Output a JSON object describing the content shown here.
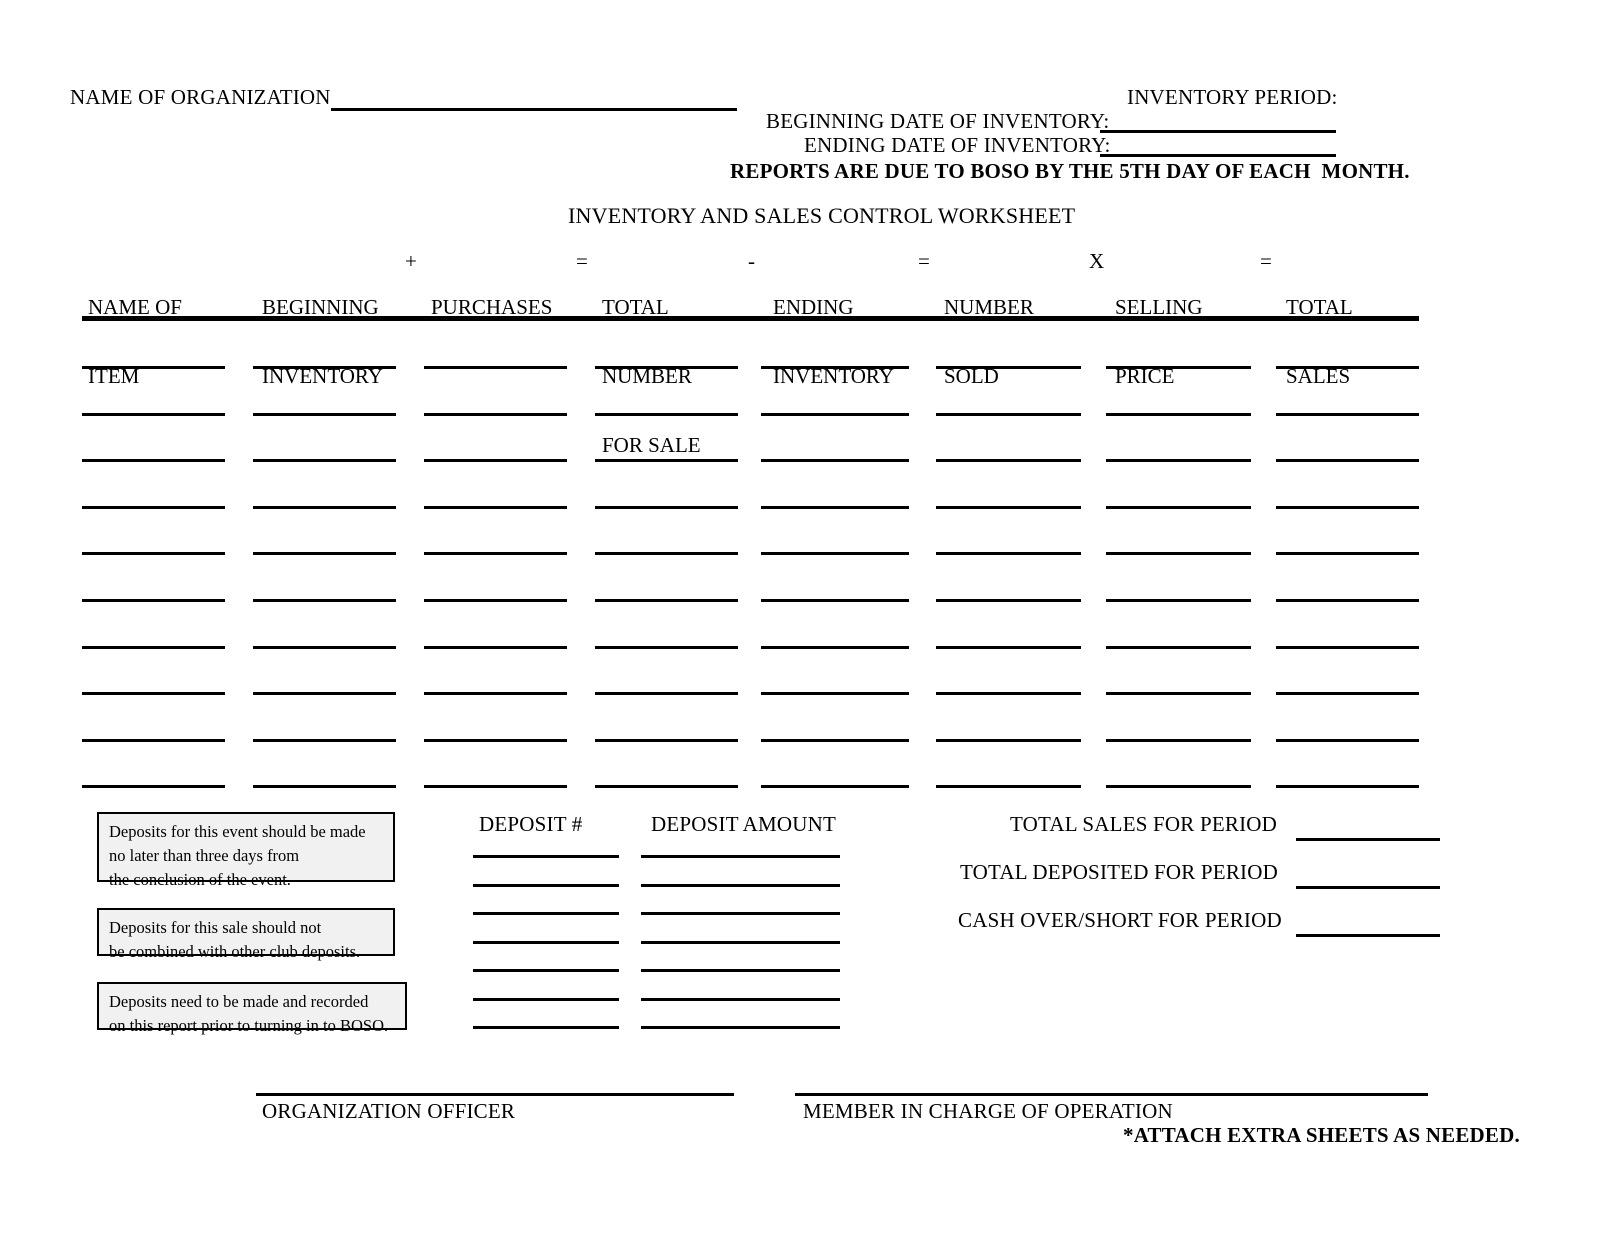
{
  "header": {
    "org_label": "NAME OF ORGANIZATION",
    "inventory_period_label": "INVENTORY PERIOD:",
    "beginning_date_label": "BEGINNING DATE OF INVENTORY:",
    "ending_date_label": "ENDING DATE OF INVENTORY:",
    "due_notice": "REPORTS ARE DUE TO BOSO BY THE 5TH DAY OF EACH  MONTH.",
    "org_value": "",
    "beginning_date_value": "",
    "ending_date_value": ""
  },
  "title": "INVENTORY AND SALES CONTROL WORKSHEET",
  "table": {
    "columns": [
      {
        "line1": "NAME OF",
        "line2": "ITEM",
        "line3": "",
        "operator": ""
      },
      {
        "line1": "BEGINNING",
        "line2": "INVENTORY",
        "line3": "",
        "operator": ""
      },
      {
        "line1": "PURCHASES",
        "line2": "",
        "line3": "",
        "operator": "+"
      },
      {
        "line1": "TOTAL",
        "line2": "NUMBER",
        "line3": "FOR SALE",
        "operator": "="
      },
      {
        "line1": "ENDING",
        "line2": "INVENTORY",
        "line3": "",
        "operator": "-"
      },
      {
        "line1": "NUMBER",
        "line2": "SOLD",
        "line3": "",
        "operator": "="
      },
      {
        "line1": "SELLING",
        "line2": "PRICE",
        "line3": "",
        "operator": "X"
      },
      {
        "line1": "TOTAL",
        "line2": "SALES",
        "line3": "",
        "operator": "="
      }
    ],
    "row_count": 10,
    "rows": [
      [
        "",
        "",
        "",
        "",
        "",
        "",
        "",
        ""
      ],
      [
        "",
        "",
        "",
        "",
        "",
        "",
        "",
        ""
      ],
      [
        "",
        "",
        "",
        "",
        "",
        "",
        "",
        ""
      ],
      [
        "",
        "",
        "",
        "",
        "",
        "",
        "",
        ""
      ],
      [
        "",
        "",
        "",
        "",
        "",
        "",
        "",
        ""
      ],
      [
        "",
        "",
        "",
        "",
        "",
        "",
        "",
        ""
      ],
      [
        "",
        "",
        "",
        "",
        "",
        "",
        "",
        ""
      ],
      [
        "",
        "",
        "",
        "",
        "",
        "",
        "",
        ""
      ],
      [
        "",
        "",
        "",
        "",
        "",
        "",
        "",
        ""
      ],
      [
        "",
        "",
        "",
        "",
        "",
        "",
        "",
        ""
      ]
    ]
  },
  "notes": [
    {
      "lines": [
        "Deposits for this event should be made",
        "no later than three days from",
        "the conclusion of the event."
      ]
    },
    {
      "lines": [
        "Deposits for this sale should not",
        "be combined with other club deposits."
      ]
    },
    {
      "lines": [
        "Deposits need to be made and recorded",
        "on this report prior to turning in to BOSO."
      ]
    }
  ],
  "deposits": {
    "number_header": "DEPOSIT #",
    "amount_header": "DEPOSIT AMOUNT",
    "row_count": 7,
    "rows": [
      {
        "number": "",
        "amount": ""
      },
      {
        "number": "",
        "amount": ""
      },
      {
        "number": "",
        "amount": ""
      },
      {
        "number": "",
        "amount": ""
      },
      {
        "number": "",
        "amount": ""
      },
      {
        "number": "",
        "amount": ""
      },
      {
        "number": "",
        "amount": ""
      }
    ]
  },
  "totals": [
    {
      "label": "TOTAL SALES FOR PERIOD",
      "value": ""
    },
    {
      "label": "TOTAL DEPOSITED FOR PERIOD",
      "value": ""
    },
    {
      "label": "CASH OVER/SHORT FOR PERIOD",
      "value": ""
    }
  ],
  "signatures": [
    {
      "label": "ORGANIZATION OFFICER",
      "value": ""
    },
    {
      "label": "MEMBER IN CHARGE OF OPERATION",
      "value": ""
    }
  ],
  "footer_note": "*ATTACH EXTRA SHEETS AS NEEDED.",
  "colors": {
    "ink": "#000000",
    "note_fill": "#f1f1f1",
    "paper": "#ffffff"
  }
}
